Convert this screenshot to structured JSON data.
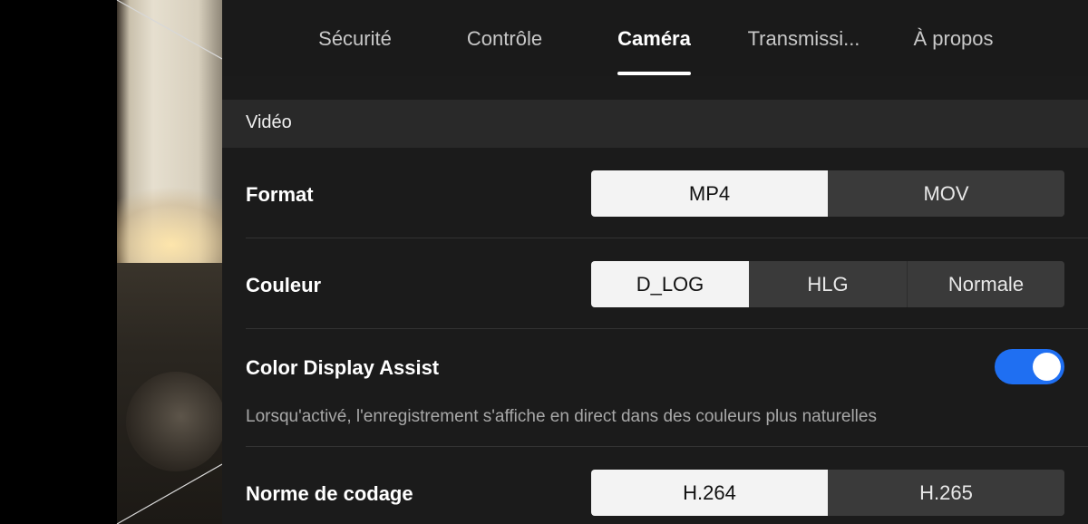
{
  "tabs": [
    {
      "label": "Sécurité"
    },
    {
      "label": "Contrôle"
    },
    {
      "label": "Caméra"
    },
    {
      "label": "Transmissi..."
    },
    {
      "label": "À propos"
    }
  ],
  "active_tab": "Caméra",
  "section": {
    "title": "Vidéo"
  },
  "format": {
    "label": "Format",
    "options": [
      "MP4",
      "MOV"
    ],
    "selected": "MP4"
  },
  "couleur": {
    "label": "Couleur",
    "options": [
      "D_LOG",
      "HLG",
      "Normale"
    ],
    "selected": "D_LOG"
  },
  "color_display_assist": {
    "label": "Color Display Assist",
    "enabled": true,
    "description": "Lorsqu'activé, l'enregistrement s'affiche en direct dans des couleurs plus naturelles"
  },
  "codage": {
    "label": "Norme de codage",
    "options": [
      "H.264",
      "H.265"
    ],
    "selected": "H.264"
  },
  "colors": {
    "accent": "#1f6ff2",
    "panel_bg": "#1b1b1b",
    "section_bg": "#292929",
    "segment_selected": "#f3f3f3",
    "segment_unselected": "#3a3a3a"
  }
}
